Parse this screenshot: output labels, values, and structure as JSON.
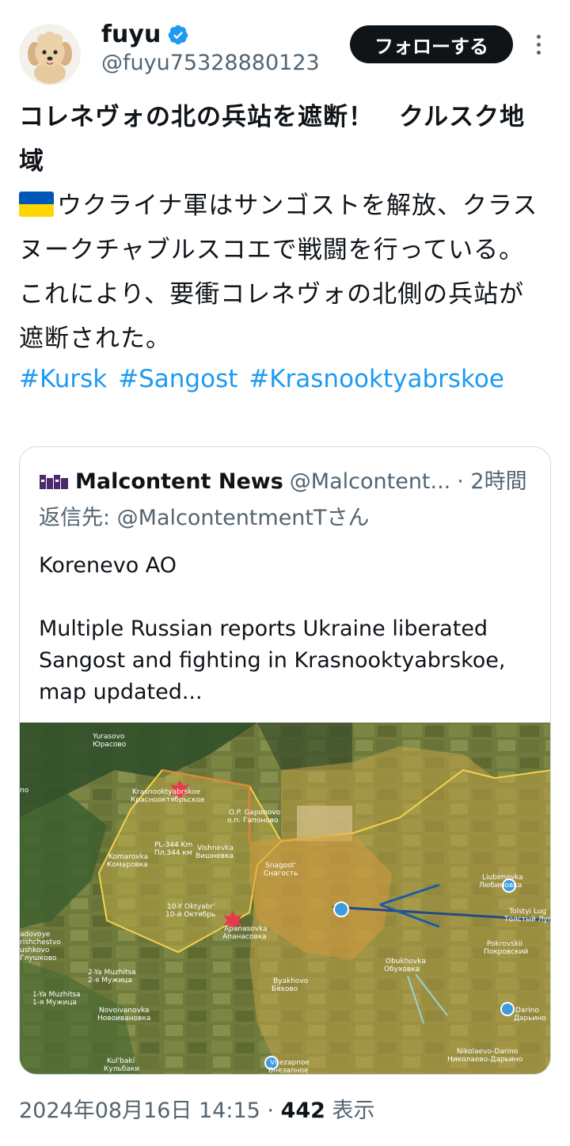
{
  "author": {
    "display_name": "fuyu",
    "handle": "@fuyu75328880123",
    "avatar": "dog-avatar-icon",
    "verified": true
  },
  "actions": {
    "follow_label": "フォローする",
    "more": "more-icon"
  },
  "tweet": {
    "title": "コレネヴォの北の兵站を遮断！　クルスク地域",
    "paragraph1": "ウクライナ軍はサンゴストを解放、クラスヌークチャブルスコエで戦闘を行っている。",
    "paragraph2": "これにより、要衝コレネヴォの北側の兵站が遮断された。",
    "hashtags": [
      "#Kursk",
      "#Sangost",
      "#Krasnooktyabrskoe"
    ],
    "flag": "ukraine-flag"
  },
  "quote": {
    "name": "Malcontent News",
    "handle": "@Malcontent...",
    "time": "· 2時間",
    "reply_to": "返信先: @MalcontentmentTさん",
    "text": "Korenevo AO\n\nMultiple Russian reports Ukraine liberated Sangost and fighting in Krasnooktyabrskoe, map updated...",
    "map_labels": [
      "Yurasovo",
      "Юрасово",
      "Krasnooktyabrskoe",
      "Красноoктябрьское",
      "O.P. Gaponovo",
      "о.п. Гапоново",
      "PL-344 Km",
      "Пл.344 км",
      "Vishnevka",
      "Вишневка",
      "Komarovka",
      "Комаровка",
      "Snagost'",
      "Снагость",
      "10-Y Oktyabr'",
      "10-й Октябрь",
      "Apanasovka",
      "Апанасовка",
      "Liubimovka",
      "Любимовка",
      "Tolstyi Lug",
      "Толстый Луг",
      "Pokrovskii",
      "Покровский",
      "Obukhovka",
      "Обуховка",
      "Byakhovo",
      "Бяхово",
      "2-Ya Muzhitsa",
      "2-я Мужица",
      "1-Ya Muzhitsa",
      "1-я Мужица",
      "Novoivanovka",
      "Новоивановка",
      "Darino",
      "Дарьино",
      "Nikolaevo-Darino",
      "Николаево-Дарьино",
      "Kul'baki",
      "Кульбаки",
      "Vnezapnoe",
      "Внезапное",
      "adovoye",
      "rishchestvo",
      "ushkovo",
      "Глушково",
      "no"
    ]
  },
  "meta": {
    "date": "2024年08月16日 14:15 · ",
    "views_count": "442",
    "views_label": " 表示"
  }
}
